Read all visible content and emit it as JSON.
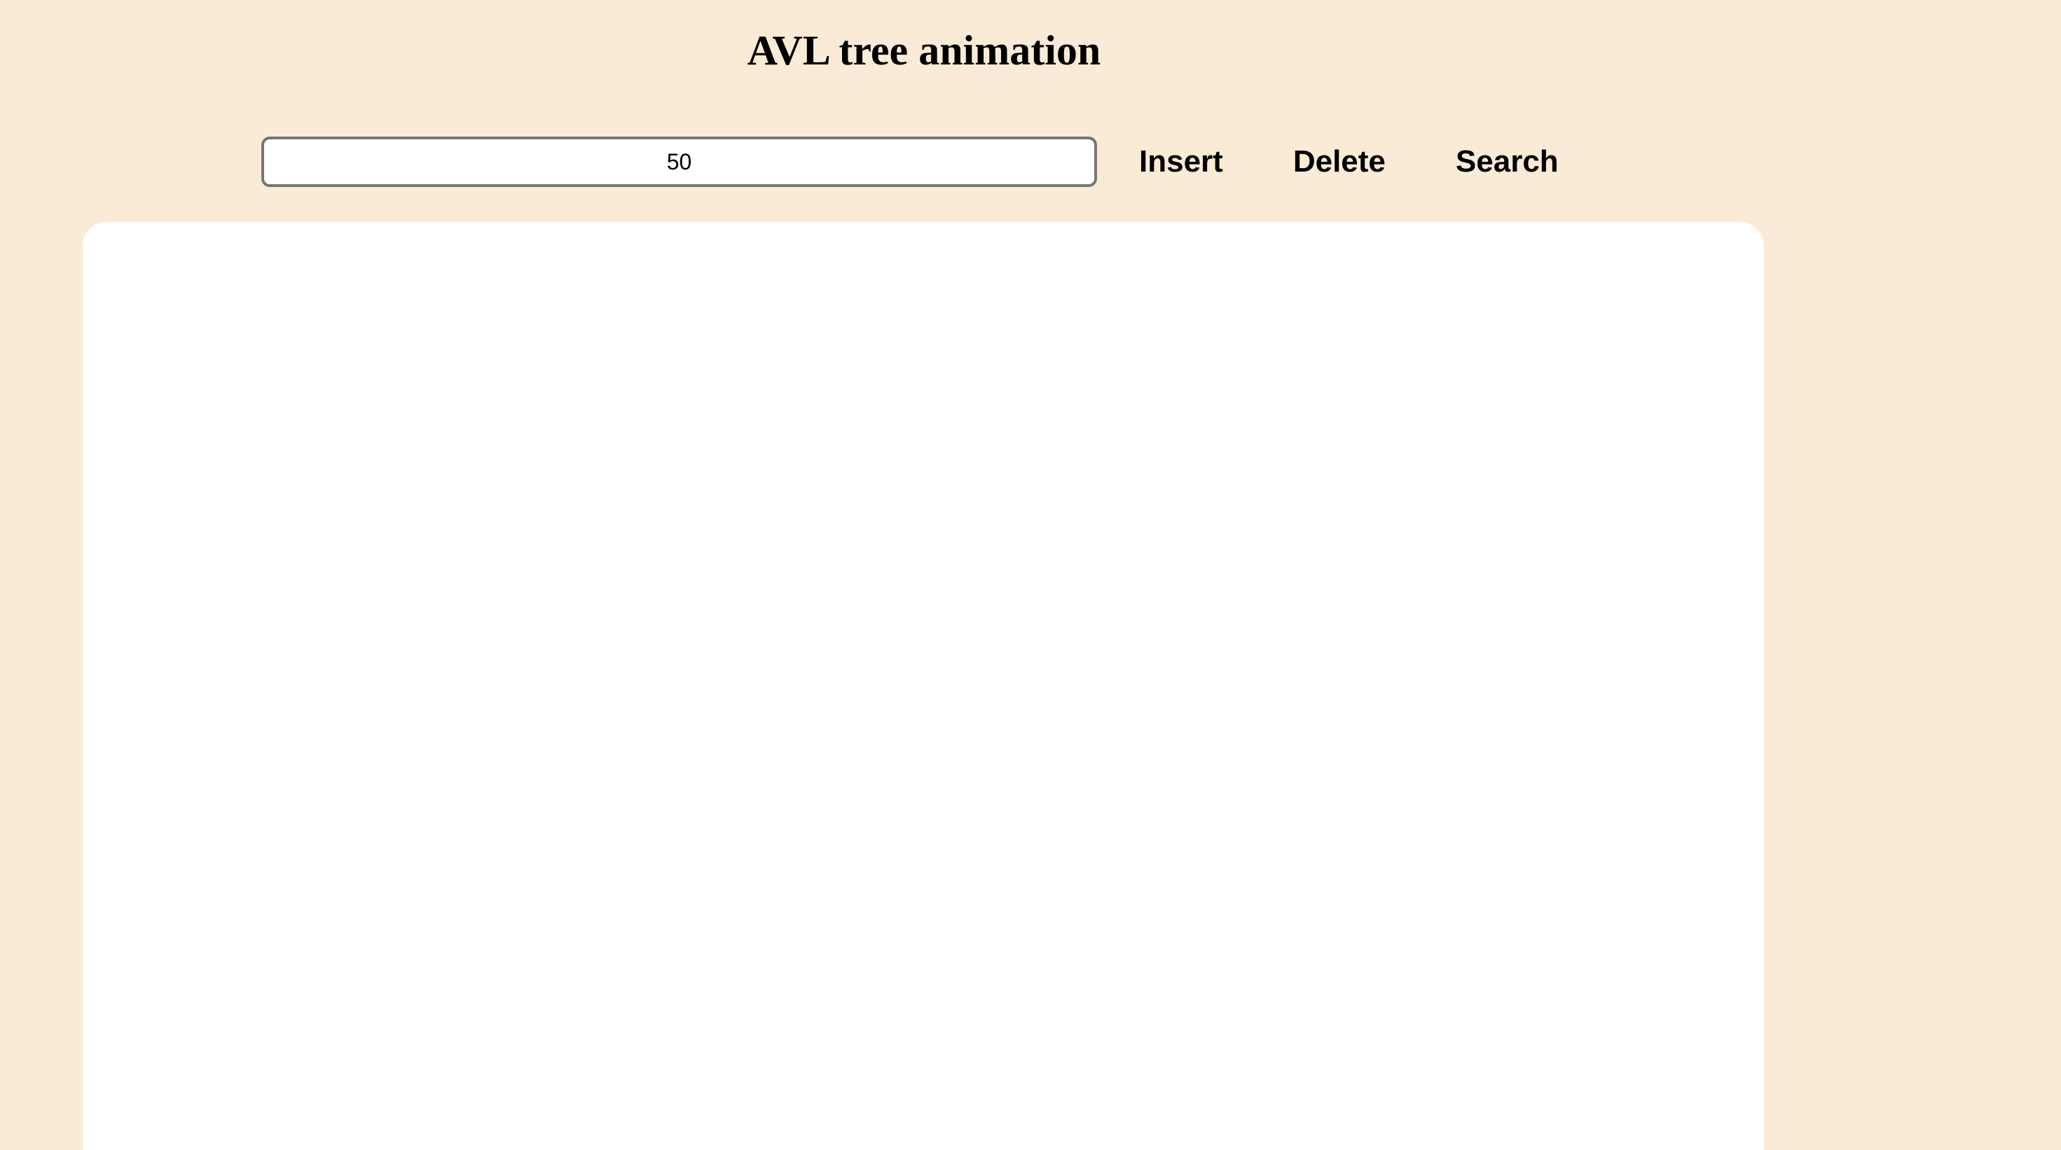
{
  "header": {
    "title": "AVL tree animation"
  },
  "controls": {
    "value_input": "50",
    "insert_label": "Insert",
    "delete_label": "Delete",
    "search_label": "Search"
  },
  "colors": {
    "background": "#faebd7",
    "canvas": "#ffffff"
  }
}
